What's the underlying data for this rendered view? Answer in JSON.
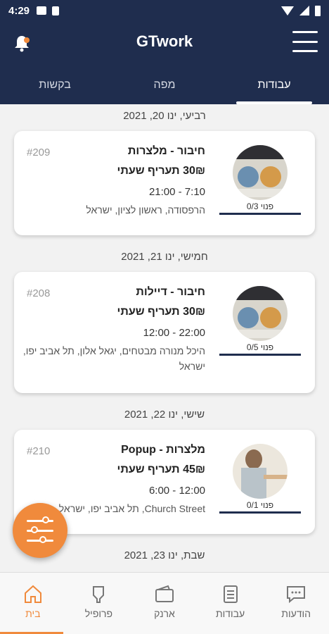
{
  "status": {
    "time": "4:29"
  },
  "header": {
    "title": "GTwork"
  },
  "tabs": [
    "בקשות",
    "מפה",
    "עבודות"
  ],
  "active_tab": "עבודות",
  "groups": [
    {
      "date": "רביעי, ינו 20, 2021",
      "job": {
        "number": "#209",
        "title": "חיבור - מלצרות",
        "rate": "30₪ תעריף שעתי",
        "hours": "21:00 - 7:10",
        "address": "הרפסודה, ראשון לציון, ישראל",
        "count": "פנוי 0/3"
      }
    },
    {
      "date": "חמישי, ינו 21, 2021",
      "job": {
        "number": "#208",
        "title": "חיבור - דיילות",
        "rate": "30₪ תעריף שעתי",
        "hours": "12:00 - 22:00",
        "address": "היכל מנורה מבטחים, יגאל אלון, תל אביב יפו, ישראל",
        "count": "פנוי 0/5"
      }
    },
    {
      "date": "שישי, ינו 22, 2021",
      "job": {
        "number": "#210",
        "title": "Popup - מלצרות",
        "rate": "45₪ תעריף שעתי",
        "hours": "6:00 - 12:00",
        "address": "תל אביב יפו, ישראל ,Church Street",
        "count": "פנוי 0/1"
      }
    }
  ],
  "next_date": "שבת, ינו 23, 2021",
  "bottom_nav": [
    "בית",
    "פרופיל",
    "ארנק",
    "עבודות",
    "הודעות"
  ],
  "colors": {
    "primary": "#1f2d4e",
    "accent": "#f08a3c"
  }
}
